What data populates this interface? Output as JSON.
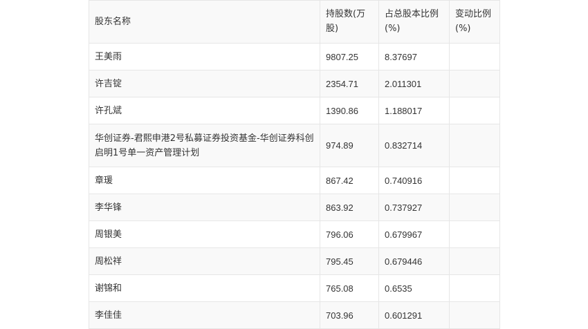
{
  "table": {
    "headers": {
      "name": "股东名称",
      "shares": "持股数(万股)",
      "ratio": "占总股本比例(%)",
      "change": "变动比例(%)"
    },
    "rows": [
      {
        "name": "王美雨",
        "shares": "9807.25",
        "ratio": "8.37697",
        "change": ""
      },
      {
        "name": "许吉锭",
        "shares": "2354.71",
        "ratio": "2.011301",
        "change": ""
      },
      {
        "name": "许孔斌",
        "shares": "1390.86",
        "ratio": "1.188017",
        "change": ""
      },
      {
        "name": "华创证券-君熙申港2号私募证券投资基金-华创证券科创启明1号单一资产管理计划",
        "shares": "974.89",
        "ratio": "0.832714",
        "change": ""
      },
      {
        "name": "章瑗",
        "shares": "867.42",
        "ratio": "0.740916",
        "change": ""
      },
      {
        "name": "李华锋",
        "shares": "863.92",
        "ratio": "0.737927",
        "change": ""
      },
      {
        "name": "周银美",
        "shares": "796.06",
        "ratio": "0.679967",
        "change": ""
      },
      {
        "name": "周松祥",
        "shares": "795.45",
        "ratio": "0.679446",
        "change": ""
      },
      {
        "name": "谢锦和",
        "shares": "765.08",
        "ratio": "0.6535",
        "change": ""
      },
      {
        "name": "李佳佳",
        "shares": "703.96",
        "ratio": "0.601291",
        "change": ""
      }
    ]
  }
}
